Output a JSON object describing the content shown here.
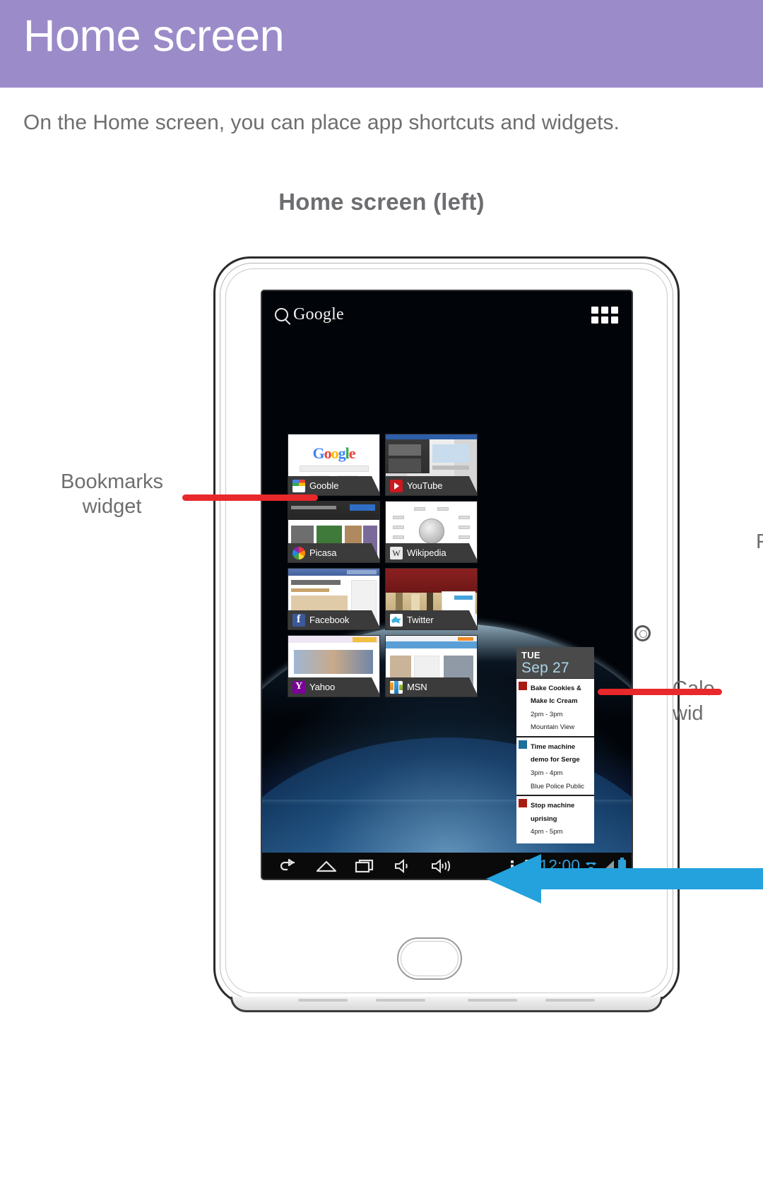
{
  "page": {
    "header_title": "Home screen",
    "intro_text": "On the Home screen, you can place app shortcuts and widgets.",
    "section_title": "Home screen (left)",
    "header_color": "#9b8bc9",
    "text_color": "#6e6e70"
  },
  "callouts": {
    "bookmarks": "Bookmarks\nwidget",
    "bookmarks_line1": "Bookmarks",
    "bookmarks_line2": "widget",
    "calendar_line1": "Cale",
    "calendar_line2": "wid",
    "right_cut": "F",
    "red_color": "#e8282a",
    "blue_color": "#23a2dd"
  },
  "device": {
    "screen": {
      "search": {
        "icon": "search-icon",
        "label": "Google"
      },
      "apps_button": {
        "icon": "apps-grid-icon",
        "label": ""
      },
      "bookmarks_widget": {
        "items": [
          {
            "name": "Gooble",
            "icon": "google-favicon"
          },
          {
            "name": "YouTube",
            "icon": "youtube-favicon"
          },
          {
            "name": "Picasa",
            "icon": "picasa-favicon"
          },
          {
            "name": "Wikipedia",
            "icon": "wikipedia-favicon"
          },
          {
            "name": "Facebook",
            "icon": "facebook-favicon"
          },
          {
            "name": "Twitter",
            "icon": "twitter-favicon"
          },
          {
            "name": "Yahoo",
            "icon": "yahoo-favicon"
          },
          {
            "name": "MSN",
            "icon": "msn-favicon"
          }
        ],
        "google_logo_letters": [
          "G",
          "o",
          "o",
          "g",
          "l",
          "e"
        ],
        "wikipedia_glyph": "W"
      },
      "calendar_widget": {
        "day_of_week": "TUE",
        "date": "Sep 27",
        "date_color": "#a9d4e8",
        "events": [
          {
            "title_line1": "Bake Cookies &",
            "title_line2": "Make Ic Cream",
            "time": "2pm - 3pm",
            "location": "Mountain View",
            "color": "#a81b12"
          },
          {
            "title_line1": "Time machine",
            "title_line2": "demo for Serge",
            "time": "3pm - 4pm",
            "location": "Blue Police Public",
            "color": "#1f6f9c"
          },
          {
            "title_line1": "Stop machine",
            "title_line2": "uprising",
            "time": "4pm - 5pm",
            "location": "",
            "color": "#a81b12"
          }
        ]
      },
      "system_bar": {
        "buttons": [
          {
            "icon": "back-icon"
          },
          {
            "icon": "home-icon"
          },
          {
            "icon": "recents-icon"
          },
          {
            "icon": "volume-down-icon"
          },
          {
            "icon": "volume-up-icon"
          }
        ],
        "menu_icon": "overflow-menu-icon",
        "sd_icon": "sd-card-icon",
        "clock": "12:00",
        "clock_color": "#2f9fd8",
        "wifi_icon": "wifi-icon",
        "signal_icon": "signal-icon",
        "battery_icon": "battery-icon"
      }
    },
    "hardware": {
      "camera_icon": "camera-sensor-icon",
      "home_button_icon": "physical-home-button"
    }
  }
}
